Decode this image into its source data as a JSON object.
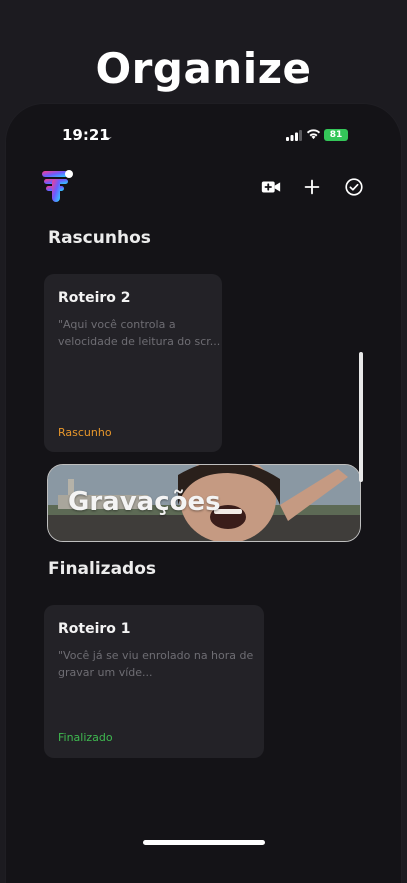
{
  "promo": {
    "title": "Organize"
  },
  "status_bar": {
    "time": "19:21",
    "battery": "81"
  },
  "sections": {
    "drafts": {
      "title": "Rascunhos",
      "card": {
        "title": "Roteiro 2",
        "preview_line1": "\"Aqui você controla a",
        "preview_line2": "velocidade de leitura do scr...",
        "status": "Rascunho"
      }
    },
    "recordings": {
      "label": "Gravações"
    },
    "finalized": {
      "title": "Finalizados",
      "card": {
        "title": "Roteiro 1",
        "preview_line1": "\"Você já se viu enrolado na hora de",
        "preview_line2": "gravar um víde...",
        "status": "Finalizado"
      }
    }
  },
  "colors": {
    "draft_status": "#e8972b",
    "finalized_status": "#3fb950",
    "battery": "#34c759"
  },
  "icons": [
    "app-logo-icon",
    "video-add-icon",
    "plus-icon",
    "check-circle-icon"
  ]
}
